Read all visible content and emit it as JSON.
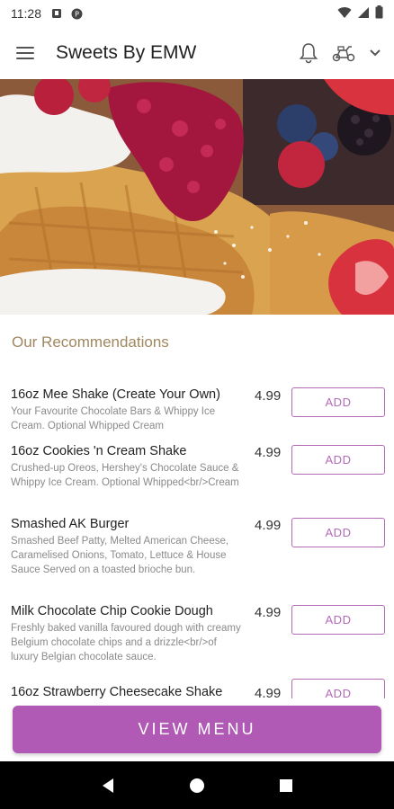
{
  "status_bar": {
    "time": "11:28"
  },
  "app_bar": {
    "title": "Sweets By EMW"
  },
  "section": {
    "title": "Our Recommendations"
  },
  "items": [
    {
      "name": "16oz Mee Shake (Create Your Own)",
      "description": "Your Favourite Chocolate Bars & Whippy Ice Cream. Optional Whipped Cream",
      "price": "4.99",
      "add_label": "ADD"
    },
    {
      "name": "16oz Cookies 'n Cream Shake",
      "description": "Crushed-up Oreos, Hershey's Chocolate Sauce & Whippy Ice Cream. Optional Whipped<br/>Cream",
      "price": "4.99",
      "add_label": "ADD"
    },
    {
      "name": "Smashed AK Burger",
      "description": "Smashed Beef Patty, Melted American Cheese, Caramelised Onions, Tomato, Lettuce & House Sauce Served on a toasted brioche bun.",
      "price": "4.99",
      "add_label": "ADD"
    },
    {
      "name": "Milk Chocolate Chip Cookie Dough",
      "description": "Freshly baked vanilla favoured dough with creamy Belgium chocolate chips and a drizzle<br/>of luxury Belgian chocolate sauce.",
      "price": "4.99",
      "add_label": "ADD"
    },
    {
      "name": "16oz Strawberry Cheesecake Shake",
      "description": "",
      "price": "4.99",
      "add_label": "ADD"
    }
  ],
  "footer": {
    "view_menu_label": "VIEW MENU"
  },
  "colors": {
    "accent": "#b05ab6",
    "section_title": "#a0875f"
  }
}
